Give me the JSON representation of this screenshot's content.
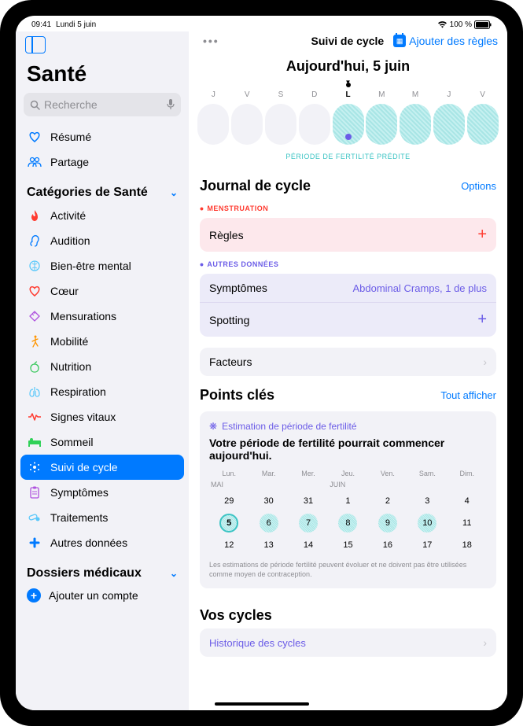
{
  "status": {
    "time": "09:41",
    "date": "Lundi 5 juin",
    "battery": "100 %"
  },
  "sidebar": {
    "title": "Santé",
    "searchPlaceholder": "Recherche",
    "top": [
      {
        "label": "Résumé",
        "icon": "heart",
        "color": "#007aff"
      },
      {
        "label": "Partage",
        "icon": "people",
        "color": "#007aff"
      }
    ],
    "catHeader": "Catégories de Santé",
    "categories": [
      {
        "label": "Activité",
        "icon": "flame",
        "color": "#ff3b30"
      },
      {
        "label": "Audition",
        "icon": "ear",
        "color": "#007aff"
      },
      {
        "label": "Bien-être mental",
        "icon": "brain",
        "color": "#5ac8fa"
      },
      {
        "label": "Cœur",
        "icon": "heart",
        "color": "#ff3b30"
      },
      {
        "label": "Mensurations",
        "icon": "ruler",
        "color": "#af52de"
      },
      {
        "label": "Mobilité",
        "icon": "walk",
        "color": "#ff9500"
      },
      {
        "label": "Nutrition",
        "icon": "apple",
        "color": "#34c759"
      },
      {
        "label": "Respiration",
        "icon": "lungs",
        "color": "#5ac8fa"
      },
      {
        "label": "Signes vitaux",
        "icon": "vitals",
        "color": "#ff3b30"
      },
      {
        "label": "Sommeil",
        "icon": "bed",
        "color": "#30d158"
      },
      {
        "label": "Suivi de cycle",
        "icon": "cycle",
        "color": "#fff",
        "active": true
      },
      {
        "label": "Symptômes",
        "icon": "clipboard",
        "color": "#af52de"
      },
      {
        "label": "Traitements",
        "icon": "pills",
        "color": "#5ac8fa"
      },
      {
        "label": "Autres données",
        "icon": "plus-data",
        "color": "#007aff"
      }
    ],
    "medHeader": "Dossiers médicaux",
    "addAccount": "Ajouter un compte"
  },
  "main": {
    "headerLabel": "Suivi de cycle",
    "addRules": "Ajouter des règles",
    "todayTitle": "Aujourd'hui, 5 juin",
    "weekDays": [
      "J",
      "V",
      "S",
      "D",
      "L",
      "M",
      "M",
      "J",
      "V"
    ],
    "todayIndex": 4,
    "fertileFrom": 4,
    "fertilityLabel": "PÉRIODE DE FERTILITÉ PRÉDITE",
    "journal": {
      "title": "Journal de cycle",
      "options": "Options",
      "menstruation": "MENSTRUATION",
      "rules": "Règles",
      "other": "AUTRES DONNÉES",
      "symptoms": "Symptômes",
      "symptomsValue": "Abdominal Cramps, 1 de plus",
      "spotting": "Spotting",
      "factors": "Facteurs"
    },
    "highlights": {
      "title": "Points clés",
      "showAll": "Tout afficher",
      "estLabel": "Estimation de période de fertilité",
      "estText": "Votre période de fertilité pourrait commencer aujourd'hui.",
      "dayHeaders": [
        "Lun.",
        "Mar.",
        "Mer.",
        "Jeu.",
        "Ven.",
        "Sam.",
        "Dim."
      ],
      "monthLeft": "MAI",
      "monthRight": "JUIN",
      "rows": [
        [
          {
            "n": 29
          },
          {
            "n": 30
          },
          {
            "n": 31
          },
          {
            "n": 1
          },
          {
            "n": 2
          },
          {
            "n": 3
          },
          {
            "n": 4
          }
        ],
        [
          {
            "n": 5,
            "f": true,
            "t": true
          },
          {
            "n": 6,
            "f": true
          },
          {
            "n": 7,
            "f": true
          },
          {
            "n": 8,
            "f": true
          },
          {
            "n": 9,
            "f": true
          },
          {
            "n": 10,
            "f": true
          },
          {
            "n": 11
          }
        ],
        [
          {
            "n": 12
          },
          {
            "n": 13
          },
          {
            "n": 14
          },
          {
            "n": 15
          },
          {
            "n": 16
          },
          {
            "n": 17
          },
          {
            "n": 18
          }
        ]
      ],
      "note": "Les estimations de période fertilité peuvent évoluer et ne doivent pas être utilisées comme moyen de contraception."
    },
    "cycles": {
      "title": "Vos cycles",
      "history": "Historique des cycles"
    }
  }
}
